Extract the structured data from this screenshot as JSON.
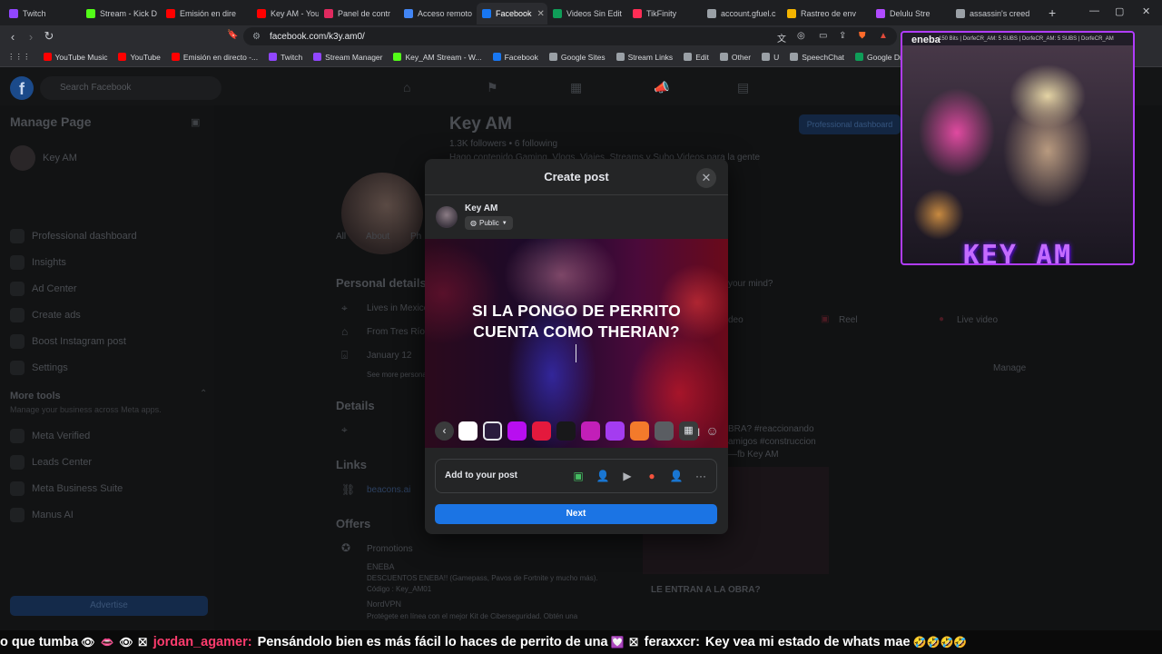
{
  "browser": {
    "tabs": [
      {
        "label": "Twitch",
        "color": "#9146ff"
      },
      {
        "label": "Stream - Kick D",
        "color": "#53fc18"
      },
      {
        "label": "Emisión en dire",
        "color": "#ff0000"
      },
      {
        "label": "Key AM - YouTu",
        "color": "#ff0000"
      },
      {
        "label": "Panel de contr",
        "color": "#e02a5f"
      },
      {
        "label": "Acceso remoto",
        "color": "#4285f4"
      },
      {
        "label": "Facebook",
        "color": "#1877f2",
        "active": true
      },
      {
        "label": "Videos Sin Edit",
        "color": "#0f9d58"
      },
      {
        "label": "TikFinity",
        "color": "#ff2d55"
      },
      {
        "label": "account.gfuel.c",
        "color": "#9aa0a6"
      },
      {
        "label": "Rastreo de env",
        "color": "#f4b400"
      },
      {
        "label": "Delulu Stre",
        "color": "#b04bff"
      },
      {
        "label": "assassin's creed",
        "color": "#9aa0a6"
      }
    ],
    "new_tab": "+",
    "url": "facebook.com/k3y.am0/",
    "bookmarks": [
      {
        "label": "YouTube Music",
        "color": "#ff0000"
      },
      {
        "label": "YouTube",
        "color": "#ff0000"
      },
      {
        "label": "Emisión en directo -...",
        "color": "#ff0000"
      },
      {
        "label": "Twitch",
        "color": "#9146ff"
      },
      {
        "label": "Stream Manager",
        "color": "#9146ff"
      },
      {
        "label": "Key_AM Stream - W...",
        "color": "#53fc18"
      },
      {
        "label": "Facebook",
        "color": "#1877f2"
      },
      {
        "label": "Google Sites",
        "color": "#9aa0a6"
      },
      {
        "label": "Stream Links",
        "color": "#9aa0a6"
      },
      {
        "label": "Edit",
        "color": "#9aa0a6"
      },
      {
        "label": "Other",
        "color": "#9aa0a6"
      },
      {
        "label": "U",
        "color": "#9aa0a6"
      },
      {
        "label": "SpeechChat",
        "color": "#9aa0a6"
      },
      {
        "label": "Google Drive",
        "color": "#0f9d58"
      }
    ]
  },
  "facebook": {
    "search_placeholder": "Search Facebook",
    "sidebar": {
      "title": "Manage Page",
      "page_name": "Key AM",
      "items": [
        "Professional dashboard",
        "Insights",
        "Ad Center",
        "Create ads",
        "Boost Instagram post",
        "Settings"
      ],
      "more_tools": "More tools",
      "more_tools_sub": "Manage your business across Meta apps.",
      "tools": [
        "Meta Verified",
        "Leads Center",
        "Meta Business Suite",
        "Manus AI"
      ],
      "advertise": "Advertise"
    },
    "profile": {
      "name": "Key AM",
      "stats": "1.3K followers • 6 following",
      "bio": "Hago contenido Gaming, Vlogs, Viajes, Streams y Subo Videos para la gente",
      "dashboard_btn": "Professional dashboard",
      "tabs": [
        "All",
        "About",
        "Ph"
      ],
      "personal_details": "Personal details",
      "lives_in": "Lives in Mexico",
      "from": "From Tres Ríos",
      "birthday": "January 12",
      "see_more": "See more personal",
      "details": "Details",
      "links": "Links",
      "link_value": "beacons.ai",
      "offers": "Offers",
      "promotions": "Promotions",
      "promo_1_title": "ENEBA",
      "promo_1_text": "DESCUENTOS ENEBA!! (Gamepass, Pavos de Fortnite y mucho más).",
      "promo_1_code": "Código : Key_AM01",
      "promo_2_title": "NordVPN",
      "promo_2_text": "Protégete en línea con el mejor Kit de Ciberseguridad. Obtén una",
      "whats_on_mind": "your mind?",
      "reel": "Reel",
      "live_video": "Live video",
      "video": "deo",
      "manage": "Manage",
      "post_tags": "BRA? #reaccionando",
      "post_tags2": "amigos #construccion",
      "post_author": "—fb Key AM",
      "post_caption": "LE ENTRAN A LA OBRA?"
    }
  },
  "modal": {
    "title": "Create post",
    "author": "Key AM",
    "audience": "Public",
    "post_text_line1": "SI LA PONGO DE PERRITO",
    "post_text_line2": "CUENTA COMO THERIAN?",
    "backgrounds": [
      {
        "name": "white",
        "color": "#ffffff"
      },
      {
        "name": "selected-dark",
        "color": "#2a1b3d"
      },
      {
        "name": "purple",
        "color": "#b80ef0"
      },
      {
        "name": "red",
        "color": "#e4193d"
      },
      {
        "name": "black",
        "color": "#18181a"
      },
      {
        "name": "magenta-gradient",
        "color": "#c21fb8"
      },
      {
        "name": "violet",
        "color": "#a43cf0"
      },
      {
        "name": "orange-gradient",
        "color": "#f37a2b"
      },
      {
        "name": "gray",
        "color": "#5a5d62"
      }
    ],
    "add_to_post": "Add to your post",
    "add_icons": [
      {
        "name": "photo",
        "glyph": "▣",
        "color": "#45bd62"
      },
      {
        "name": "tag-people",
        "glyph": "👤",
        "color": "#1877f2"
      },
      {
        "name": "video",
        "glyph": "▶",
        "color": "#b0b3b8"
      },
      {
        "name": "location",
        "glyph": "●",
        "color": "#f5533d"
      },
      {
        "name": "people",
        "glyph": "👤",
        "color": "#a970ff"
      },
      {
        "name": "more",
        "glyph": "···",
        "color": "#b0b3b8"
      }
    ],
    "next": "Next"
  },
  "stream": {
    "sponsor": "eneba",
    "banner": "150 Bits | DorfeCR_AM: 5 SUBS | DorfeCR_AM: 5 SUBS | DorfeCR_AM",
    "streamer_name": "KEY_AM"
  },
  "chat": {
    "segment_1": "o que tumba",
    "user_1": "jordan_agamer:",
    "message_1": "Pensándolo bien es más fácil lo haces de perrito de una",
    "user_2": "feraxxcr:",
    "message_2": "Key vea mi estado de whats mae",
    "user_1_color": "#ff3c6e",
    "user_2_color": "#ffffff"
  }
}
